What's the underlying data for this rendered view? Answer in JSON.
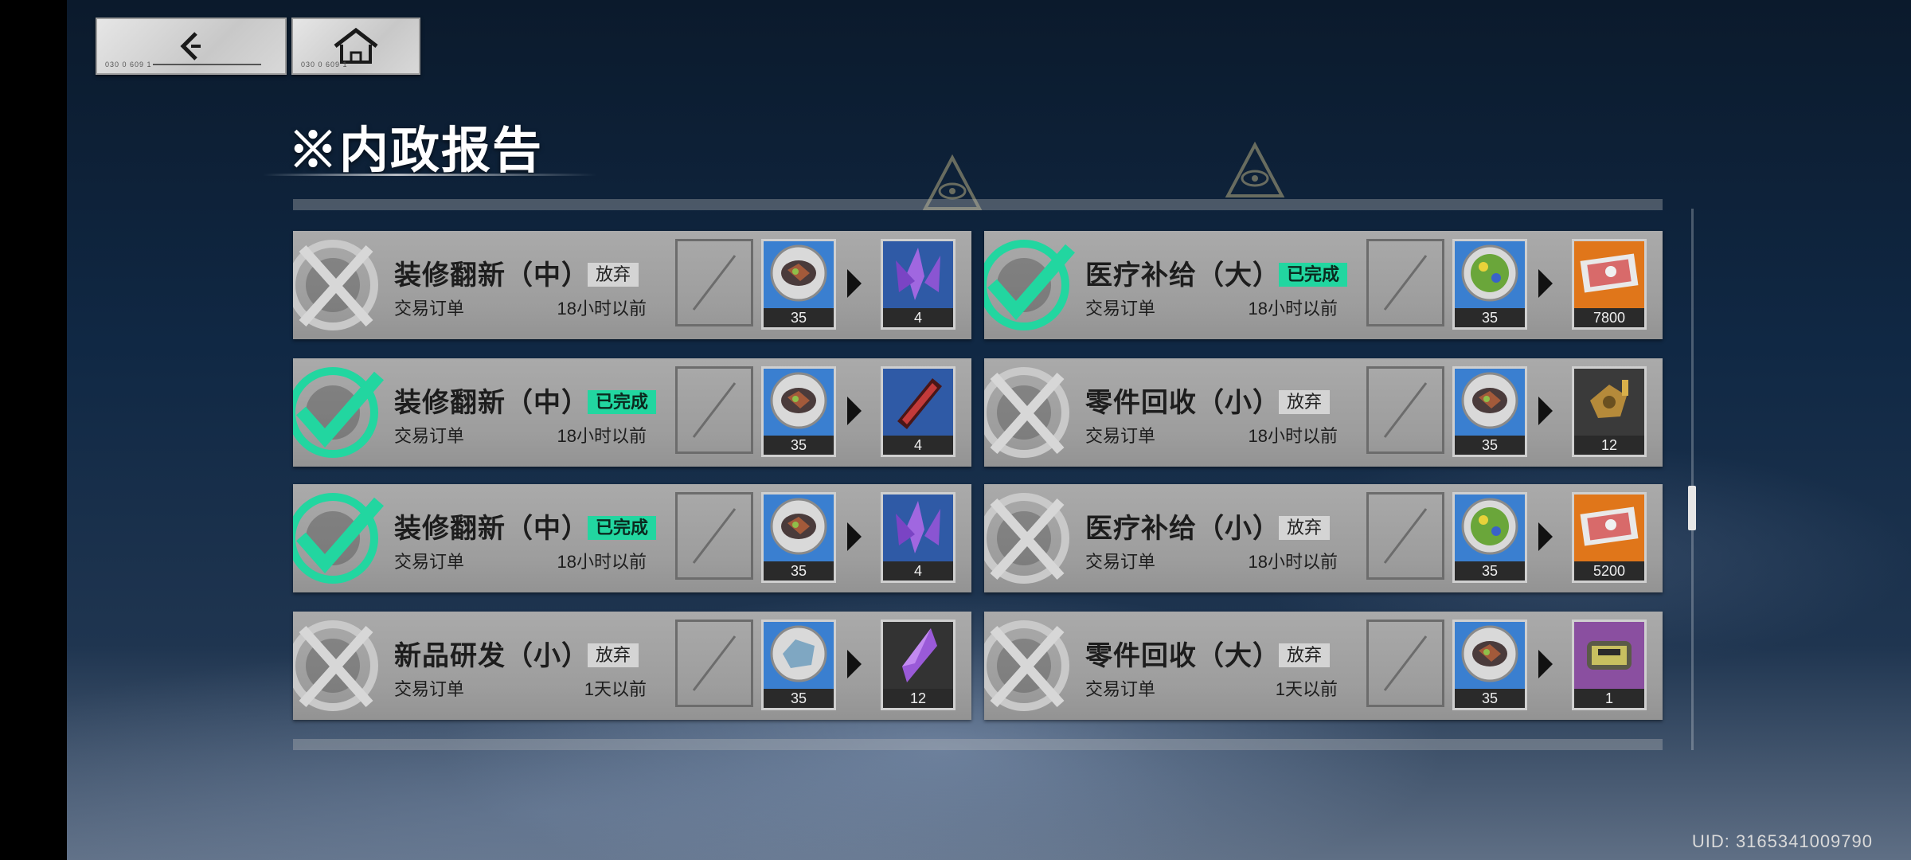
{
  "navigation": {
    "back_serial": "030 0 609 1",
    "home_serial": "030 0 609 1"
  },
  "page_title": "※内政报告",
  "colors": {
    "completed_accent": "#22d6a0",
    "abandon_badge": "#d4d4d4",
    "card_background": "#a3a3a3"
  },
  "reports": [
    {
      "status": "abandoned",
      "status_icon": "cross-mark-icon",
      "name": "装修翻新（中）",
      "badge": "放弃",
      "type": "交易订单",
      "time": "18小时以前",
      "input": {
        "icon": "mineral-ore-coin-icon",
        "count": "35"
      },
      "output": {
        "icon": "purple-crystal-cluster-icon",
        "count": "4"
      }
    },
    {
      "status": "completed",
      "status_icon": "check-mark-icon",
      "name": "医疗补给（大）",
      "badge": "已完成",
      "type": "交易订单",
      "time": "18小时以前",
      "input": {
        "icon": "green-herb-coin-icon",
        "count": "35"
      },
      "output": {
        "icon": "banknote-bundle-icon",
        "count": "7800"
      }
    },
    {
      "status": "completed",
      "status_icon": "check-mark-icon",
      "name": "装修翻新（中）",
      "badge": "已完成",
      "type": "交易订单",
      "time": "18小时以前",
      "input": {
        "icon": "mineral-ore-coin-icon",
        "count": "35"
      },
      "output": {
        "icon": "red-metal-bar-icon",
        "count": "4"
      }
    },
    {
      "status": "abandoned",
      "status_icon": "cross-mark-icon",
      "name": "零件回收（小）",
      "badge": "放弃",
      "type": "交易订单",
      "time": "18小时以前",
      "input": {
        "icon": "mineral-ore-coin-icon",
        "count": "35"
      },
      "output": {
        "icon": "gold-scrap-parts-icon",
        "count": "12"
      }
    },
    {
      "status": "completed",
      "status_icon": "check-mark-icon",
      "name": "装修翻新（中）",
      "badge": "已完成",
      "type": "交易订单",
      "time": "18小时以前",
      "input": {
        "icon": "mineral-ore-coin-icon",
        "count": "35"
      },
      "output": {
        "icon": "purple-crystal-cluster-icon",
        "count": "4"
      }
    },
    {
      "status": "abandoned",
      "status_icon": "cross-mark-icon",
      "name": "医疗补给（小）",
      "badge": "放弃",
      "type": "交易订单",
      "time": "18小时以前",
      "input": {
        "icon": "green-herb-coin-icon",
        "count": "35"
      },
      "output": {
        "icon": "banknote-bundle-icon",
        "count": "5200"
      }
    },
    {
      "status": "abandoned",
      "status_icon": "cross-mark-icon",
      "name": "新品研发（小）",
      "badge": "放弃",
      "type": "交易订单",
      "time": "1天以前",
      "input": {
        "icon": "blue-ore-coin-icon",
        "count": "35"
      },
      "output": {
        "icon": "purple-crystal-shard-icon",
        "count": "12"
      }
    },
    {
      "status": "abandoned",
      "status_icon": "cross-mark-icon",
      "name": "零件回收（大）",
      "badge": "放弃",
      "type": "交易订单",
      "time": "1天以前",
      "input": {
        "icon": "mineral-ore-coin-icon",
        "count": "35"
      },
      "output": {
        "icon": "machine-part-icon",
        "count": "1"
      }
    }
  ],
  "uid_text": "UID: 3165341009790"
}
